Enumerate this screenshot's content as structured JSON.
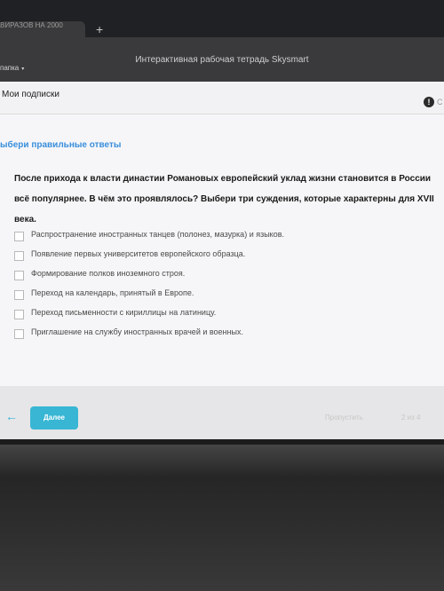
{
  "browser": {
    "tab_label": "ВИРАЗОВ НА 2000",
    "new_tab_symbol": "+"
  },
  "app": {
    "title": "Интерактивная рабочая тетрадь Skysmart",
    "folder_label": "папка",
    "folder_chevron": "▾"
  },
  "nav": {
    "subscriptions_label": "Мои подписки",
    "alert_symbol": "!",
    "alert_trailing_text": "С"
  },
  "task": {
    "heading": "ыбери правильные ответы",
    "question": "После прихода к власти династии Романовых европейский уклад жизни становится в России всё популярнее. В чём это проявлялось? Выбери три суждения, которые характерны для XVII века.",
    "options": [
      {
        "label": "Распространение иностранных танцев (полонез, мазурка) и языков.",
        "checked": false
      },
      {
        "label": "Появление первых университетов европейского образца.",
        "checked": false
      },
      {
        "label": "Формирование полков иноземного строя.",
        "checked": false
      },
      {
        "label": "Переход на календарь, принятый в Европе.",
        "checked": false
      },
      {
        "label": "Переход письменности с кириллицы на латиницу.",
        "checked": false
      },
      {
        "label": "Приглашение на службу иностранных врачей и военных.",
        "checked": false
      }
    ]
  },
  "footer": {
    "back_symbol": "←",
    "next_label": "Далее",
    "skip_label": "Пропустить",
    "progress": "2 из 4"
  },
  "colors": {
    "accent": "#38b6d4",
    "heading": "#3a8fdc"
  }
}
